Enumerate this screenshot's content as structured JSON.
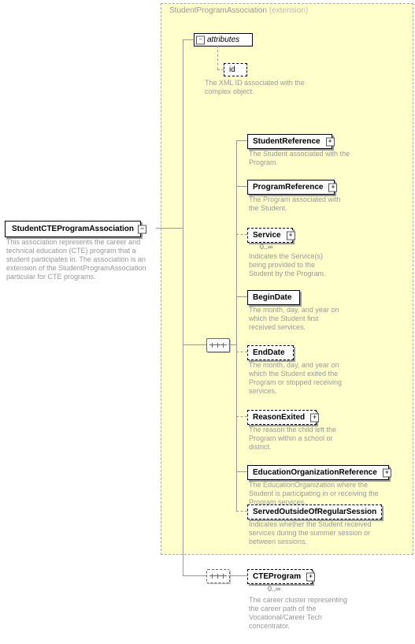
{
  "root": {
    "label": "StudentCTEProgramAssociation",
    "desc": "This association represents the career and technical education (CTE) program that a student participates in. The association is an extension of the StudentProgramAssociation particular for CTE programs."
  },
  "extension": {
    "title_prefix": "StudentProgramAssociation",
    "title_suffix": "(extension)"
  },
  "attributes": {
    "label": "attributes",
    "id": {
      "label": "id",
      "desc": "The XML ID associated with the complex object."
    }
  },
  "items": [
    {
      "label": "StudentReference",
      "optional": false,
      "card": "",
      "desc": "The Student associated with the Program."
    },
    {
      "label": "ProgramReference",
      "optional": false,
      "card": "",
      "desc": "The Program associated with the Student."
    },
    {
      "label": "Service",
      "optional": true,
      "card": "0..∞",
      "desc": "Indicates the Service(s) being provided to the Student by the Program."
    },
    {
      "label": "BeginDate",
      "optional": false,
      "card": "",
      "desc": "The month, day, and year on which the Student first received services."
    },
    {
      "label": "EndDate",
      "optional": true,
      "card": "",
      "desc": "The month, day, and year on which the Student exited the Program or stopped receiving services."
    },
    {
      "label": "ReasonExited",
      "optional": true,
      "card": "",
      "desc": "The reason the child left the Program within a school or district."
    },
    {
      "label": "EducationOrganizationReference",
      "optional": false,
      "card": "",
      "desc": "The EducationOrganization where the Student is participating in or receiving the Program services."
    },
    {
      "label": "ServedOutsideOfRegularSession",
      "optional": true,
      "card": "",
      "desc": "Indicates whether the Student received services during the summer session or between sessions."
    }
  ],
  "cte": {
    "label": "CTEProgram",
    "card": "0..∞",
    "desc": "The career cluster representing the career path of the Vocational/Career Tech concentrator."
  }
}
